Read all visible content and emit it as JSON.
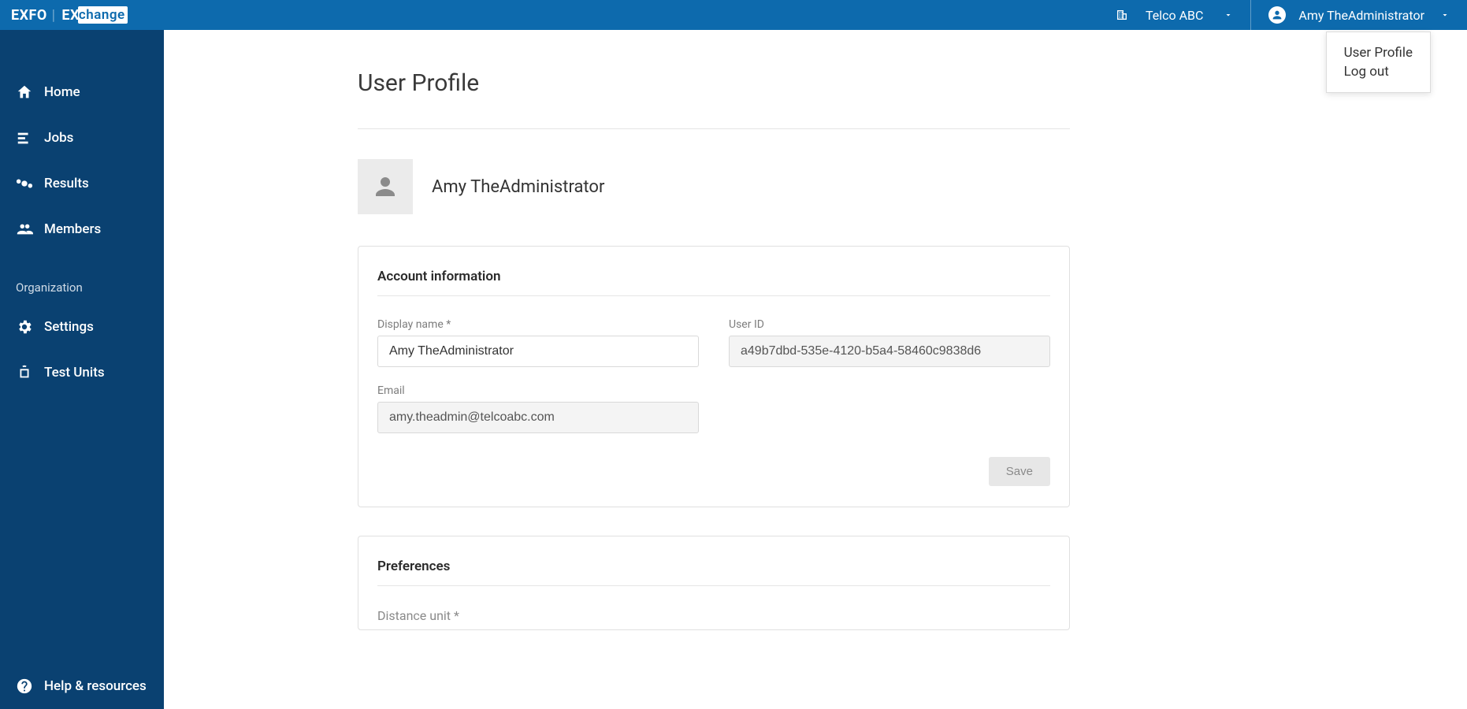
{
  "header": {
    "logo_left": "EXFO",
    "logo_mid": "EX",
    "logo_badge": "change",
    "org_name": "Telco ABC",
    "user_name": "Amy TheAdministrator"
  },
  "dropdown": {
    "items": [
      "User Profile",
      "Log out"
    ]
  },
  "sidebar": {
    "items": [
      {
        "label": "Home"
      },
      {
        "label": "Jobs"
      },
      {
        "label": "Results"
      },
      {
        "label": "Members"
      }
    ],
    "section_label": "Organization",
    "org_items": [
      {
        "label": "Settings"
      },
      {
        "label": "Test Units"
      }
    ],
    "help_label": "Help & resources"
  },
  "page": {
    "title": "User Profile",
    "profile_name": "Amy TheAdministrator"
  },
  "account": {
    "section_title": "Account information",
    "display_name_label": "Display name *",
    "display_name_value": "Amy TheAdministrator",
    "user_id_label": "User ID",
    "user_id_value": "a49b7dbd-535e-4120-b5a4-58460c9838d6",
    "email_label": "Email",
    "email_value": "amy.theadmin@telcoabc.com",
    "save_label": "Save"
  },
  "preferences": {
    "section_title": "Preferences",
    "distance_label": "Distance unit *"
  }
}
